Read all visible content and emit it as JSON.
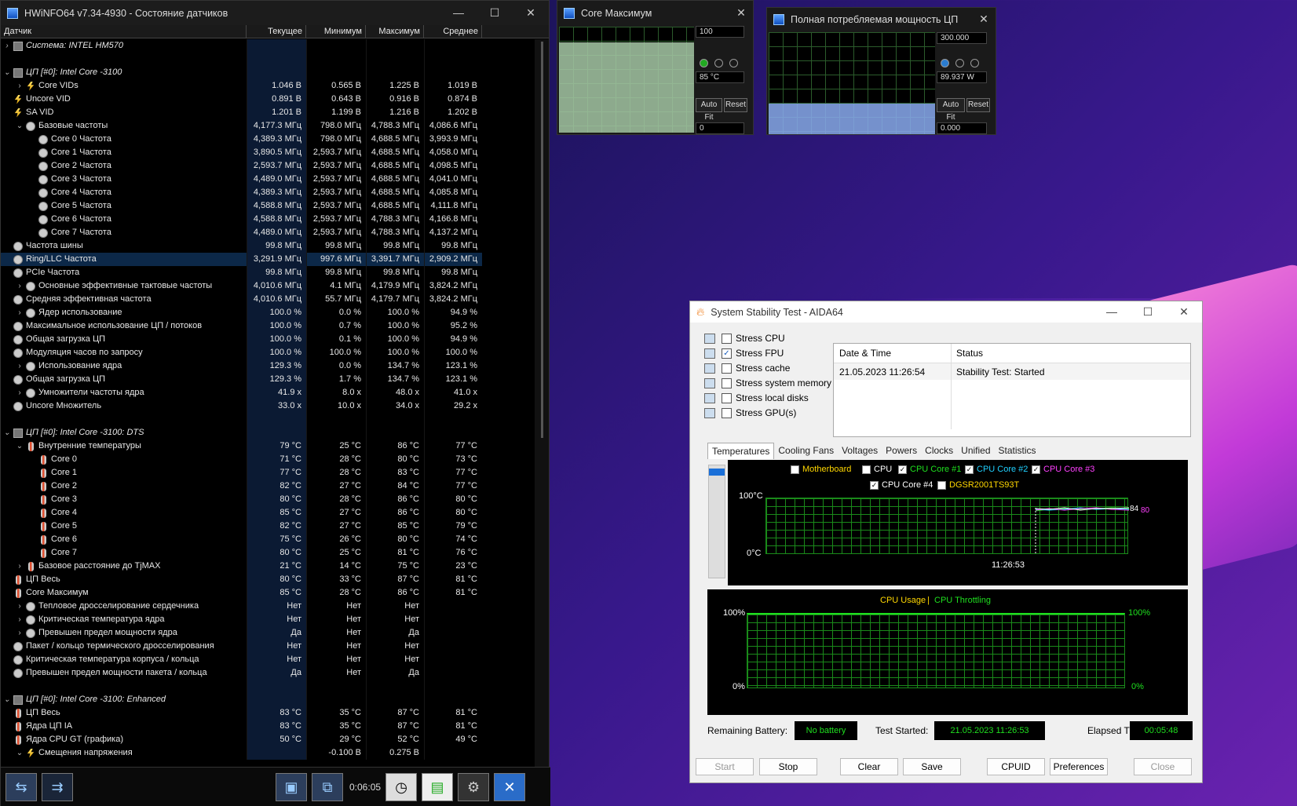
{
  "hwinfo": {
    "title": "HWiNFO64 v7.34-4930 - Состояние датчиков",
    "columns": [
      "Датчик",
      "Текущее",
      "Минимум",
      "Максимум",
      "Среднее"
    ],
    "timer": "0:06:05",
    "rows": [
      {
        "label": "Система: INTEL HM570",
        "cur": "",
        "min": "",
        "max": "",
        "avg": "",
        "exp": "›",
        "icon": "chip",
        "indent": 0,
        "grp": true
      },
      {
        "label": "",
        "cur": "",
        "min": "",
        "max": "",
        "avg": "",
        "exp": "",
        "icon": "",
        "indent": 0
      },
      {
        "label": "ЦП [#0]: Intel Core -3100",
        "cur": "",
        "min": "",
        "max": "",
        "avg": "",
        "exp": "⌄",
        "icon": "chip",
        "indent": 0,
        "grp": true
      },
      {
        "label": "Core VIDs",
        "cur": "1.046 В",
        "min": "0.565 В",
        "max": "1.225 В",
        "avg": "1.019 В",
        "exp": "›",
        "icon": "volt",
        "indent": 1
      },
      {
        "label": "Uncore VID",
        "cur": "0.891 В",
        "min": "0.643 В",
        "max": "0.916 В",
        "avg": "0.874 В",
        "exp": "",
        "icon": "volt",
        "indent": 0
      },
      {
        "label": "SA VID",
        "cur": "1.201 В",
        "min": "1.199 В",
        "max": "1.216 В",
        "avg": "1.202 В",
        "exp": "",
        "icon": "volt",
        "indent": 0
      },
      {
        "label": "Базовые частоты",
        "cur": "4,177.3 МГц",
        "min": "798.0 МГц",
        "max": "4,788.3 МГц",
        "avg": "4,086.6 МГц",
        "exp": "⌄",
        "icon": "clock",
        "indent": 1
      },
      {
        "label": "Core 0 Частота",
        "cur": "4,389.3 МГц",
        "min": "798.0 МГц",
        "max": "4,688.5 МГц",
        "avg": "3,993.9 МГц",
        "exp": "",
        "icon": "clock",
        "indent": 2
      },
      {
        "label": "Core 1 Частота",
        "cur": "3,890.5 МГц",
        "min": "2,593.7 МГц",
        "max": "4,688.5 МГц",
        "avg": "4,058.0 МГц",
        "exp": "",
        "icon": "clock",
        "indent": 2
      },
      {
        "label": "Core 2 Частота",
        "cur": "2,593.7 МГц",
        "min": "2,593.7 МГц",
        "max": "4,688.5 МГц",
        "avg": "4,098.5 МГц",
        "exp": "",
        "icon": "clock",
        "indent": 2
      },
      {
        "label": "Core 3 Частота",
        "cur": "4,489.0 МГц",
        "min": "2,593.7 МГц",
        "max": "4,688.5 МГц",
        "avg": "4,041.0 МГц",
        "exp": "",
        "icon": "clock",
        "indent": 2
      },
      {
        "label": "Core 4 Частота",
        "cur": "4,389.3 МГц",
        "min": "2,593.7 МГц",
        "max": "4,688.5 МГц",
        "avg": "4,085.8 МГц",
        "exp": "",
        "icon": "clock",
        "indent": 2
      },
      {
        "label": "Core 5 Частота",
        "cur": "4,588.8 МГц",
        "min": "2,593.7 МГц",
        "max": "4,688.5 МГц",
        "avg": "4,111.8 МГц",
        "exp": "",
        "icon": "clock",
        "indent": 2
      },
      {
        "label": "Core 6 Частота",
        "cur": "4,588.8 МГц",
        "min": "2,593.7 МГц",
        "max": "4,788.3 МГц",
        "avg": "4,166.8 МГц",
        "exp": "",
        "icon": "clock",
        "indent": 2
      },
      {
        "label": "Core 7 Частота",
        "cur": "4,489.0 МГц",
        "min": "2,593.7 МГц",
        "max": "4,788.3 МГц",
        "avg": "4,137.2 МГц",
        "exp": "",
        "icon": "clock",
        "indent": 2
      },
      {
        "label": "Частота шины",
        "cur": "99.8 МГц",
        "min": "99.8 МГц",
        "max": "99.8 МГц",
        "avg": "99.8 МГц",
        "exp": "",
        "icon": "clock",
        "indent": 0
      },
      {
        "label": "Ring/LLC Частота",
        "cur": "3,291.9 МГц",
        "min": "997.6 МГц",
        "max": "3,391.7 МГц",
        "avg": "2,909.2 МГц",
        "exp": "",
        "icon": "clock",
        "indent": 0,
        "sel": true
      },
      {
        "label": "PCIe Частота",
        "cur": "99.8 МГц",
        "min": "99.8 МГц",
        "max": "99.8 МГц",
        "avg": "99.8 МГц",
        "exp": "",
        "icon": "clock",
        "indent": 0
      },
      {
        "label": "Основные эффективные тактовые частоты",
        "cur": "4,010.6 МГц",
        "min": "4.1 МГц",
        "max": "4,179.9 МГц",
        "avg": "3,824.2 МГц",
        "exp": "›",
        "icon": "clock",
        "indent": 1
      },
      {
        "label": "Средняя эффективная частота",
        "cur": "4,010.6 МГц",
        "min": "55.7 МГц",
        "max": "4,179.7 МГц",
        "avg": "3,824.2 МГц",
        "exp": "",
        "icon": "clock",
        "indent": 0
      },
      {
        "label": "Ядер использование",
        "cur": "100.0 %",
        "min": "0.0 %",
        "max": "100.0 %",
        "avg": "94.9 %",
        "exp": "›",
        "icon": "clock",
        "indent": 1
      },
      {
        "label": "Максимальное использование ЦП / потоков",
        "cur": "100.0 %",
        "min": "0.7 %",
        "max": "100.0 %",
        "avg": "95.2 %",
        "exp": "",
        "icon": "clock",
        "indent": 0
      },
      {
        "label": "Общая загрузка ЦП",
        "cur": "100.0 %",
        "min": "0.1 %",
        "max": "100.0 %",
        "avg": "94.9 %",
        "exp": "",
        "icon": "clock",
        "indent": 0
      },
      {
        "label": "Модуляция часов по запросу",
        "cur": "100.0 %",
        "min": "100.0 %",
        "max": "100.0 %",
        "avg": "100.0 %",
        "exp": "",
        "icon": "clock",
        "indent": 0
      },
      {
        "label": "Использование ядра",
        "cur": "129.3 %",
        "min": "0.0 %",
        "max": "134.7 %",
        "avg": "123.1 %",
        "exp": "›",
        "icon": "clock",
        "indent": 1
      },
      {
        "label": "Общая загрузка ЦП",
        "cur": "129.3 %",
        "min": "1.7 %",
        "max": "134.7 %",
        "avg": "123.1 %",
        "exp": "",
        "icon": "clock",
        "indent": 0
      },
      {
        "label": "Умножители частоты ядра",
        "cur": "41.9 x",
        "min": "8.0 x",
        "max": "48.0 x",
        "avg": "41.0 x",
        "exp": "›",
        "icon": "clock",
        "indent": 1
      },
      {
        "label": "Uncore Множитель",
        "cur": "33.0 x",
        "min": "10.0 x",
        "max": "34.0 x",
        "avg": "29.2 x",
        "exp": "",
        "icon": "clock",
        "indent": 0
      },
      {
        "label": "",
        "cur": "",
        "min": "",
        "max": "",
        "avg": "",
        "exp": "",
        "icon": "",
        "indent": 0
      },
      {
        "label": "ЦП [#0]: Intel Core -3100: DTS",
        "cur": "",
        "min": "",
        "max": "",
        "avg": "",
        "exp": "⌄",
        "icon": "chip",
        "indent": 0,
        "grp": true
      },
      {
        "label": "Внутренние температуры",
        "cur": "79 °C",
        "min": "25 °C",
        "max": "86 °C",
        "avg": "77 °C",
        "exp": "⌄",
        "icon": "temp",
        "indent": 1
      },
      {
        "label": "Core 0",
        "cur": "71 °C",
        "min": "28 °C",
        "max": "80 °C",
        "avg": "73 °C",
        "exp": "",
        "icon": "temp",
        "indent": 2
      },
      {
        "label": "Core 1",
        "cur": "77 °C",
        "min": "28 °C",
        "max": "83 °C",
        "avg": "77 °C",
        "exp": "",
        "icon": "temp",
        "indent": 2
      },
      {
        "label": "Core 2",
        "cur": "82 °C",
        "min": "27 °C",
        "max": "84 °C",
        "avg": "77 °C",
        "exp": "",
        "icon": "temp",
        "indent": 2
      },
      {
        "label": "Core 3",
        "cur": "80 °C",
        "min": "28 °C",
        "max": "86 °C",
        "avg": "80 °C",
        "exp": "",
        "icon": "temp",
        "indent": 2
      },
      {
        "label": "Core 4",
        "cur": "85 °C",
        "min": "27 °C",
        "max": "86 °C",
        "avg": "80 °C",
        "exp": "",
        "icon": "temp",
        "indent": 2
      },
      {
        "label": "Core 5",
        "cur": "82 °C",
        "min": "27 °C",
        "max": "85 °C",
        "avg": "79 °C",
        "exp": "",
        "icon": "temp",
        "indent": 2
      },
      {
        "label": "Core 6",
        "cur": "75 °C",
        "min": "26 °C",
        "max": "80 °C",
        "avg": "74 °C",
        "exp": "",
        "icon": "temp",
        "indent": 2
      },
      {
        "label": "Core 7",
        "cur": "80 °C",
        "min": "25 °C",
        "max": "81 °C",
        "avg": "76 °C",
        "exp": "",
        "icon": "temp",
        "indent": 2
      },
      {
        "label": "Базовое расстояние до TjMAX",
        "cur": "21 °C",
        "min": "14 °C",
        "max": "75 °C",
        "avg": "23 °C",
        "exp": "›",
        "icon": "temp",
        "indent": 1
      },
      {
        "label": "ЦП Весь",
        "cur": "80 °C",
        "min": "33 °C",
        "max": "87 °C",
        "avg": "81 °C",
        "exp": "",
        "icon": "temp",
        "indent": 0
      },
      {
        "label": "Core Максимум",
        "cur": "85 °C",
        "min": "28 °C",
        "max": "86 °C",
        "avg": "81 °C",
        "exp": "",
        "icon": "temp",
        "indent": 0
      },
      {
        "label": "Тепловое дросселирование сердечника",
        "cur": "Нет",
        "min": "Нет",
        "max": "Нет",
        "avg": "",
        "exp": "›",
        "icon": "clock",
        "indent": 1
      },
      {
        "label": "Критическая температура ядра",
        "cur": "Нет",
        "min": "Нет",
        "max": "Нет",
        "avg": "",
        "exp": "›",
        "icon": "clock",
        "indent": 1
      },
      {
        "label": "Превышен предел мощности ядра",
        "cur": "Да",
        "min": "Нет",
        "max": "Да",
        "avg": "",
        "exp": "›",
        "icon": "clock",
        "indent": 1
      },
      {
        "label": "Пакет / кольцо термического дросселирования",
        "cur": "Нет",
        "min": "Нет",
        "max": "Нет",
        "avg": "",
        "exp": "",
        "icon": "clock",
        "indent": 0
      },
      {
        "label": "Критическая температура корпуса / кольца",
        "cur": "Нет",
        "min": "Нет",
        "max": "Нет",
        "avg": "",
        "exp": "",
        "icon": "clock",
        "indent": 0
      },
      {
        "label": "Превышен предел мощности пакета / кольца",
        "cur": "Да",
        "min": "Нет",
        "max": "Да",
        "avg": "",
        "exp": "",
        "icon": "clock",
        "indent": 0
      },
      {
        "label": "",
        "cur": "",
        "min": "",
        "max": "",
        "avg": "",
        "exp": "",
        "icon": "",
        "indent": 0
      },
      {
        "label": "ЦП [#0]: Intel Core -3100: Enhanced",
        "cur": "",
        "min": "",
        "max": "",
        "avg": "",
        "exp": "⌄",
        "icon": "chip",
        "indent": 0,
        "grp": true
      },
      {
        "label": "ЦП Весь",
        "cur": "83 °C",
        "min": "35 °C",
        "max": "87 °C",
        "avg": "81 °C",
        "exp": "",
        "icon": "temp",
        "indent": 0
      },
      {
        "label": "Ядра ЦП IA",
        "cur": "83 °C",
        "min": "35 °C",
        "max": "87 °C",
        "avg": "81 °C",
        "exp": "",
        "icon": "temp",
        "indent": 0
      },
      {
        "label": "Ядра CPU GT (графика)",
        "cur": "50 °C",
        "min": "29 °C",
        "max": "52 °C",
        "avg": "49 °C",
        "exp": "",
        "icon": "temp",
        "indent": 0
      },
      {
        "label": "Смещения напряжения",
        "cur": "",
        "min": "-0.100 В",
        "max": "0.275 В",
        "avg": "",
        "exp": "⌄",
        "icon": "volt",
        "indent": 1
      }
    ]
  },
  "core_max": {
    "title": "Core Максимум",
    "top": "100",
    "current": "85 °C",
    "bottom": "0",
    "autofit": "Auto Fit",
    "reset": "Reset",
    "fill_color": "#a6c8a6",
    "level": 0.85
  },
  "power": {
    "title": "Полная потребляемая мощность ЦП",
    "top": "300.000",
    "current": "89.937 W",
    "bottom": "0.000",
    "autofit": "Auto Fit",
    "reset": "Reset",
    "fill_color": "#8aaaf0",
    "level": 0.3
  },
  "aida": {
    "title": "System Stability Test - AIDA64",
    "stress": [
      {
        "label": "Stress CPU",
        "checked": ""
      },
      {
        "label": "Stress FPU",
        "checked": "✓"
      },
      {
        "label": "Stress cache",
        "checked": ""
      },
      {
        "label": "Stress system memory",
        "checked": ""
      },
      {
        "label": "Stress local disks",
        "checked": ""
      },
      {
        "label": "Stress GPU(s)",
        "checked": ""
      }
    ],
    "log_header": {
      "date": "Date & Time",
      "status": "Status"
    },
    "log": [
      {
        "date": "21.05.2023 11:26:54",
        "status": "Stability Test: Started"
      }
    ],
    "tabs": [
      "Temperatures",
      "Cooling Fans",
      "Voltages",
      "Powers",
      "Clocks",
      "Unified",
      "Statistics"
    ],
    "temp_legend": [
      {
        "label": "Motherboard",
        "checked": "",
        "color": "#ffd700"
      },
      {
        "label": "CPU",
        "checked": "",
        "color": "#ffffff"
      },
      {
        "label": "CPU Core #1",
        "checked": "✓",
        "color": "#1fe01f"
      },
      {
        "label": "CPU Core #2",
        "checked": "✓",
        "color": "#20d0ff"
      },
      {
        "label": "CPU Core #3",
        "checked": "✓",
        "color": "#ff40ff"
      },
      {
        "label": "CPU Core #4",
        "checked": "✓",
        "color": "#ffffff"
      },
      {
        "label": "DGSR2001TS93T",
        "checked": "",
        "color": "#ffd700"
      }
    ],
    "temp_y_top": "100°C",
    "temp_y_bottom": "0°C",
    "temp_time": "11:26:53",
    "temp_val1": "84",
    "temp_val2": "80",
    "usage_title1": "CPU Usage",
    "usage_sep": "|",
    "usage_title2": "CPU Throttling",
    "usage_y_top": "100%",
    "usage_y_bottom": "0%",
    "usage_right_top": "100%",
    "usage_right_bottom": "0%",
    "battery_label": "Remaining Battery:",
    "battery_value": "No battery",
    "started_label": "Test Started:",
    "started_value": "21.05.2023 11:26:53",
    "elapsed_label": "Elapsed Time:",
    "elapsed_value": "00:05:48",
    "buttons": {
      "start": "Start",
      "stop": "Stop",
      "clear": "Clear",
      "save": "Save",
      "cpuid": "CPUID",
      "prefs": "Preferences",
      "close": "Close"
    }
  },
  "chart_data": {
    "type": "line",
    "ylabel": "°C",
    "ylim": [
      0,
      100
    ],
    "series": [
      {
        "name": "CPU Core #1"
      },
      {
        "name": "CPU Core #2"
      },
      {
        "name": "CPU Core #3"
      },
      {
        "name": "CPU Core #4"
      }
    ],
    "x_label_start": "11:26:53",
    "end_values": [
      84,
      80
    ]
  }
}
